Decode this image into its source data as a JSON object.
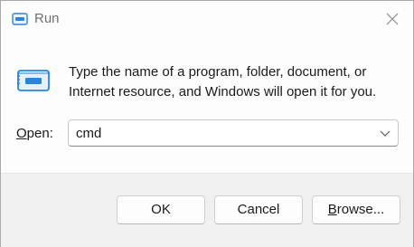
{
  "window": {
    "title": "Run",
    "icon": "run-icon",
    "close_icon": "close-icon"
  },
  "content": {
    "description": "Type the name of a program, folder, document, or Internet resource, and Windows will open it for you.",
    "open_label_mnemonic": "O",
    "open_label_rest": "pen:",
    "open_value": "cmd",
    "dropdown_icon": "chevron-down-icon"
  },
  "buttons": {
    "ok": "OK",
    "cancel": "Cancel",
    "browse_mnemonic": "B",
    "browse_rest": "rowse..."
  },
  "colors": {
    "accent": "#2b84d8",
    "dialog_bg": "#fdfdfd",
    "footer_bg": "#f0f0f0"
  }
}
